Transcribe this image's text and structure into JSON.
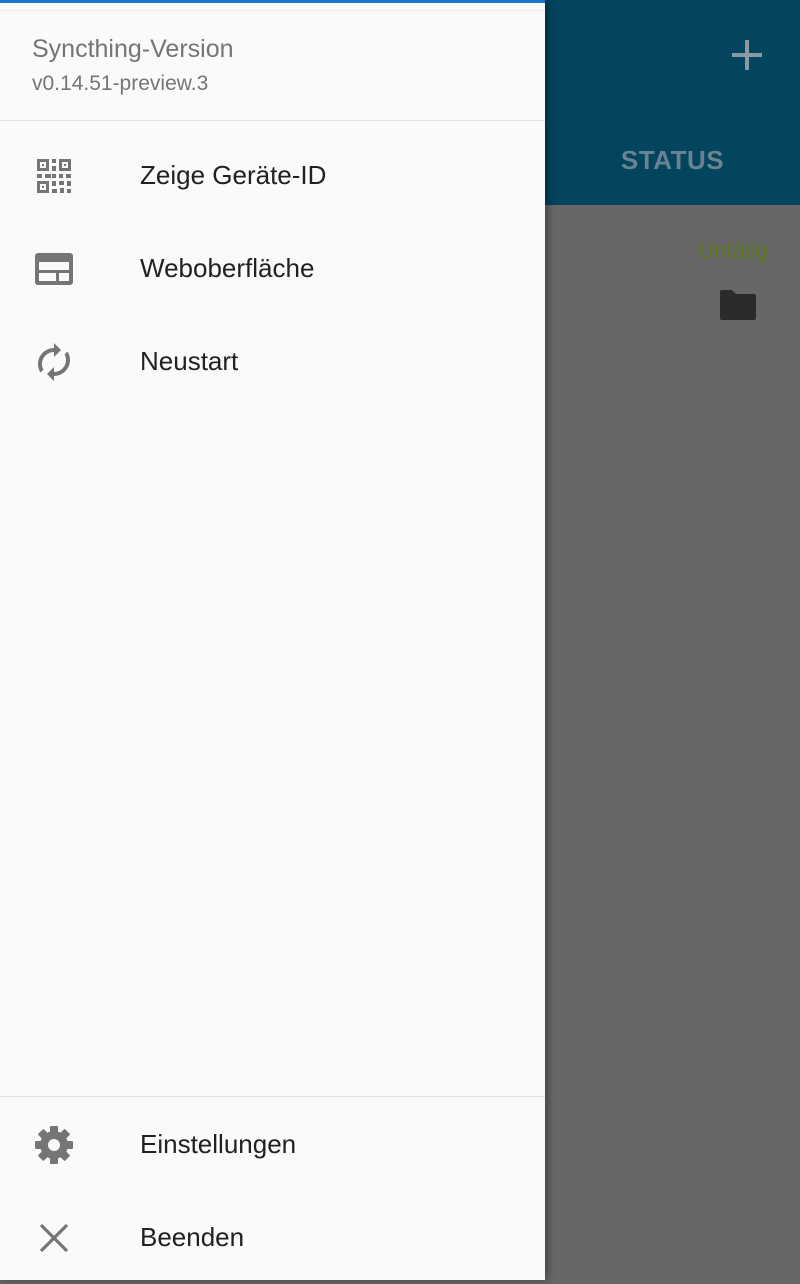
{
  "app_bar": {
    "add_icon": "plus-icon",
    "tab_status": "STATUS",
    "accent_color": "#03445f"
  },
  "content": {
    "folder_status": "Untätig",
    "folder_icon": "folder-icon",
    "status_color": "#5d7a1f"
  },
  "drawer": {
    "version_title": "Syncthing-Version",
    "version_value": "v0.14.51-preview.3",
    "items": [
      {
        "label": "Zeige Geräte-ID",
        "icon": "qr-code-icon"
      },
      {
        "label": "Weboberfläche",
        "icon": "web-gui-icon"
      },
      {
        "label": "Neustart",
        "icon": "restart-icon"
      }
    ],
    "bottom_items": [
      {
        "label": "Einstellungen",
        "icon": "gear-icon"
      },
      {
        "label": "Beenden",
        "icon": "close-icon"
      }
    ]
  }
}
